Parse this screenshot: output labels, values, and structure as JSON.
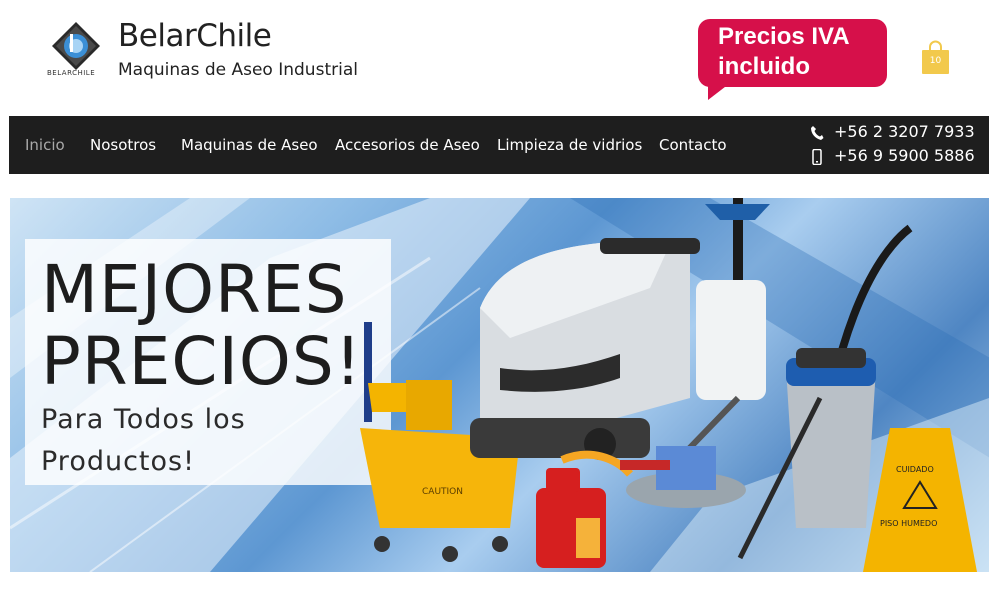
{
  "header": {
    "brand": "BelarChile",
    "tagline": "Maquinas de Aseo Industrial",
    "logo_caption": "BELARCHILE",
    "iva_line1": "Precios IVA",
    "iva_line2": "incluido",
    "cart_count": "10"
  },
  "nav": {
    "items": [
      {
        "label": "Inicio",
        "active": true
      },
      {
        "label": "Nosotros"
      },
      {
        "label": "Maquinas de Aseo"
      },
      {
        "label": "Accesorios de Aseo"
      },
      {
        "label": "Limpieza de vidrios"
      },
      {
        "label": "Contacto"
      }
    ],
    "phone_landline": "+56 2 3207 7933",
    "phone_mobile": "+56 9 5900 5886"
  },
  "hero": {
    "line1": "MEJORES",
    "line2": "PRECIOS!",
    "sub1": "Para Todos los",
    "sub2": "Productos!",
    "bucket_label": "CAUTION",
    "sign_label1": "CUIDADO",
    "sign_label2": "PISO HUMEDO"
  },
  "colors": {
    "accent": "#d6104a",
    "nav_bg": "#1e1e1e",
    "cart": "#f2c94c"
  }
}
